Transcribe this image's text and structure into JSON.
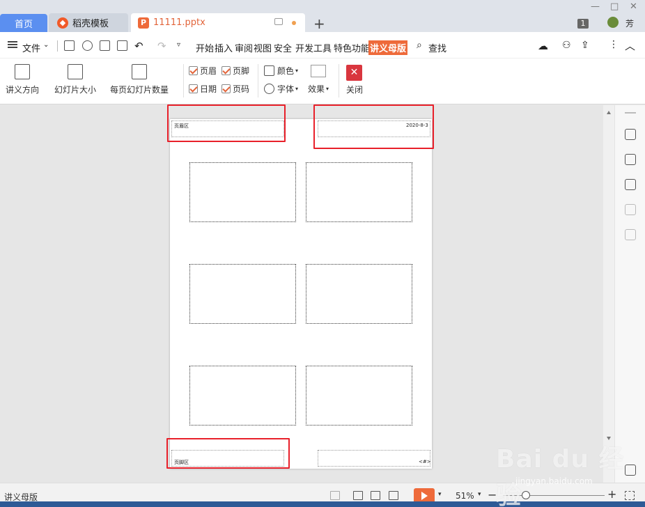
{
  "tabs": {
    "home": "首页",
    "template": "稻壳模板",
    "file": "11111.pptx",
    "new_tab": "+"
  },
  "window": {
    "badge": "1",
    "user": "芳",
    "minimize": "—",
    "maximize": "□",
    "close": "✕"
  },
  "menu": {
    "file": "文件",
    "items": [
      "开始",
      "插入",
      "审阅",
      "视图",
      "安全",
      "开发工具",
      "特色功能",
      "讲义母版"
    ],
    "search": "查找"
  },
  "ribbon": {
    "orientation": "讲义方向",
    "slide_size": "幻灯片大小",
    "slides_per_page": "每页幻灯片数量",
    "header": "页眉",
    "footer": "页脚",
    "date": "日期",
    "page_number": "页码",
    "color": "颜色",
    "font": "字体",
    "effects": "效果",
    "close": "关闭",
    "checkbox_states": {
      "header": true,
      "footer": true,
      "date": true,
      "page_number": true
    }
  },
  "page": {
    "header_text": "页眉区",
    "date_text": "2020-8-3",
    "footer_text": "页脚区",
    "page_num_text": "<#>"
  },
  "status": {
    "mode": "讲义母版",
    "zoom": "51%"
  },
  "colors": {
    "accent": "#ee6a3a",
    "home_tab": "#5b8ff0",
    "highlight_box": "#e8202a",
    "close_button": "#d9363e"
  },
  "watermark": {
    "brand": "Bai du 经验",
    "url": "jingyan.baidu.com"
  }
}
